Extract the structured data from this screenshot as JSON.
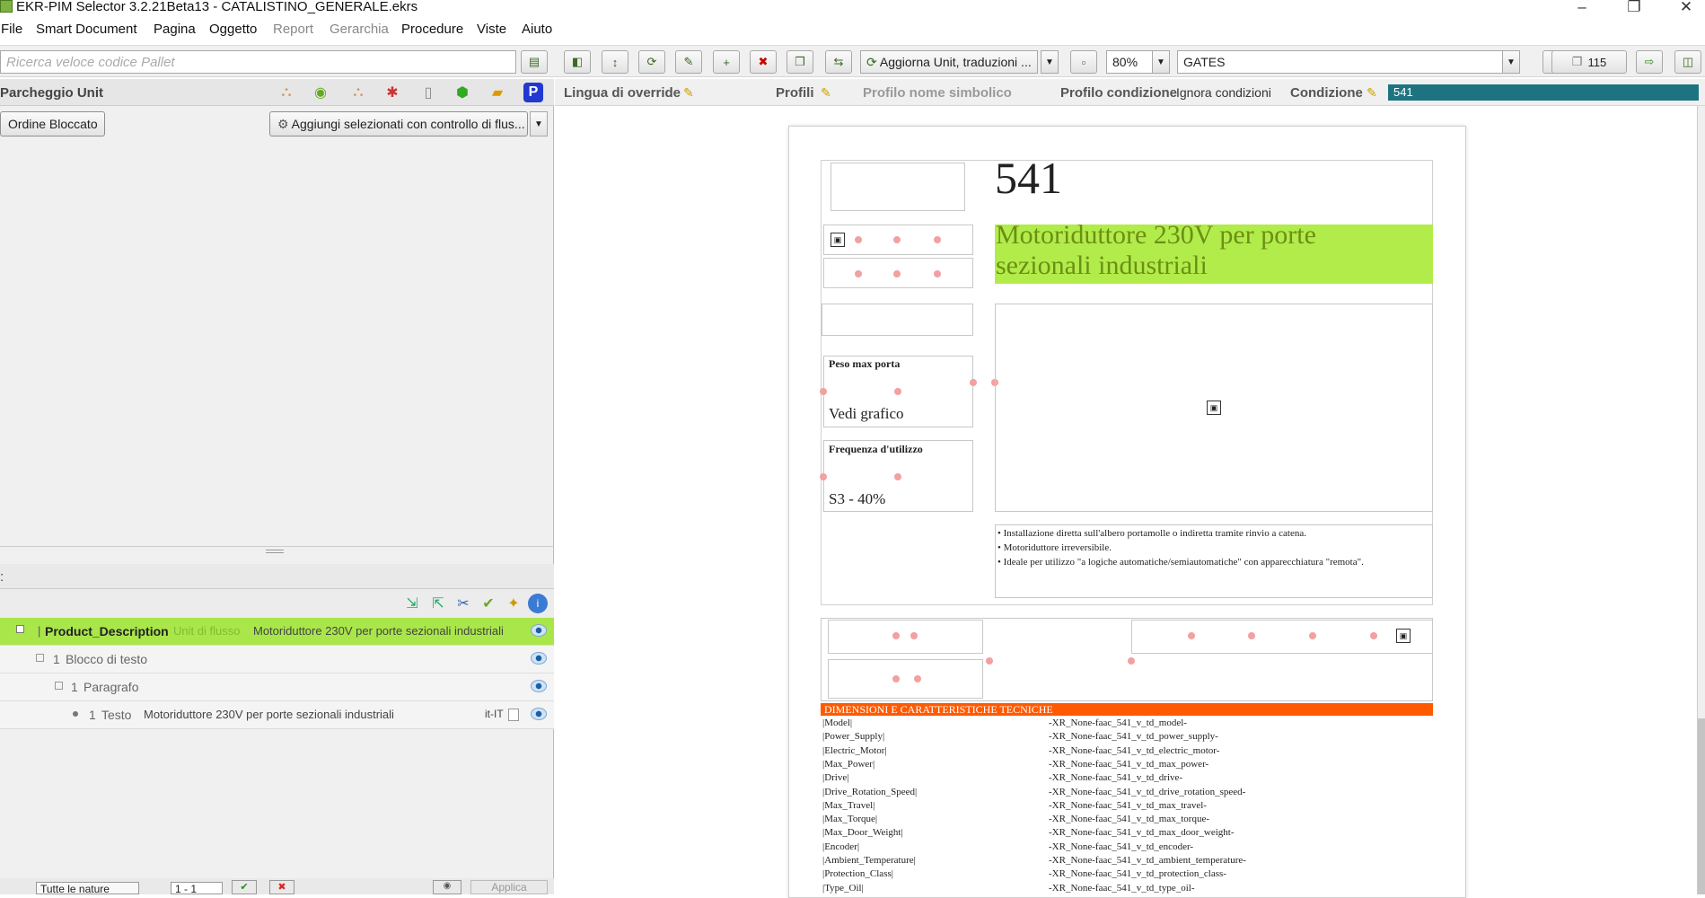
{
  "window": {
    "title": "EKR-PIM Selector 3.2.21Beta13 - CATALISTINO_GENERALE.ekrs",
    "minimize": "–",
    "restore": "❐",
    "close": "✕"
  },
  "menu": [
    "File",
    "Smart Document",
    "Pagina",
    "Oggetto",
    "Report",
    "Gerarchia",
    "Procedure",
    "Viste",
    "Aiuto"
  ],
  "toolbar": {
    "search_placeholder": "Ricerca veloce codice Pallet",
    "action_combo": "Aggiorna Unit, traduzioni ...",
    "zoom": "80%",
    "brand_combo": "GATES",
    "page_count": "115"
  },
  "left_panel": {
    "title": "Parcheggio Unit",
    "ordine_button": "Ordine Bloccato",
    "aggiungi_combo": "Aggiungi selezionati con controllo di flus...",
    "lower_title": ":",
    "tree": [
      {
        "label": "Product_Description",
        "type": "Unit di flusso",
        "text": "Motoriduttore 230V per porte sezionali industriali",
        "index": "1"
      },
      {
        "label": "Blocco di testo",
        "index": "1"
      },
      {
        "label": "Paragrafo",
        "index": "1"
      },
      {
        "label": "Testo",
        "index": "1",
        "text": "Motoriduttore 230V per porte sezionali industriali",
        "lang": "it-IT"
      }
    ],
    "bottom_filter": "Tutte le nature",
    "bottom_range": "1 - 1",
    "apply_label": "Applica"
  },
  "right_header": {
    "lingua_label": "Lingua di override",
    "profili_label": "Profili",
    "profilo_nome_label": "Profilo nome simbolico",
    "profilo_condizione_label": "Profilo condizione",
    "profilo_condizione_value": "Ignora condizioni",
    "condizione_label": "Condizione",
    "condizione_value": "541"
  },
  "document": {
    "code": "541",
    "title_line1": "Motoriduttore 230V per porte",
    "title_line2": "sezionali industriali",
    "peso_label": "Peso max porta",
    "peso_value": "Vedi grafico",
    "freq_label": "Frequenza d'utilizzo",
    "freq_value": "S3 - 40%",
    "bullets": [
      "• Installazione diretta sull'albero portamolle o indiretta tramite rinvio a catena.",
      "• Motoriduttore irreversibile.",
      "• Ideale per utilizzo \"a logiche automatiche/semiautomatiche\" con apparecchiatura \"remota\"."
    ],
    "section_title": "DIMENSIONI E CARATTERISTICHE TECNICHE",
    "specs": [
      {
        "k": "|Model|",
        "v": "-XR_None-faac_541_v_td_model-"
      },
      {
        "k": "|Power_Supply|",
        "v": "-XR_None-faac_541_v_td_power_supply-"
      },
      {
        "k": "|Electric_Motor|",
        "v": "-XR_None-faac_541_v_td_electric_motor-"
      },
      {
        "k": "|Max_Power|",
        "v": "-XR_None-faac_541_v_td_max_power-"
      },
      {
        "k": "|Drive|",
        "v": "-XR_None-faac_541_v_td_drive-"
      },
      {
        "k": "|Drive_Rotation_Speed|",
        "v": "-XR_None-faac_541_v_td_drive_rotation_speed-"
      },
      {
        "k": "|Max_Travel|",
        "v": "-XR_None-faac_541_v_td_max_travel-"
      },
      {
        "k": "|Max_Torque|",
        "v": "-XR_None-faac_541_v_td_max_torque-"
      },
      {
        "k": "|Max_Door_Weight|",
        "v": "-XR_None-faac_541_v_td_max_door_weight-"
      },
      {
        "k": "|Encoder|",
        "v": "-XR_None-faac_541_v_td_encoder-"
      },
      {
        "k": "|Ambient_Temperature|",
        "v": "-XR_None-faac_541_v_td_ambient_temperature-"
      },
      {
        "k": "|Protection_Class|",
        "v": "-XR_None-faac_541_v_td_protection_class-"
      },
      {
        "k": "|Type_Oil|",
        "v": "-XR_None-faac_541_v_td_type_oil-"
      }
    ]
  },
  "colors": {
    "accent_green": "#a9e64a",
    "section_orange": "#ff5a00",
    "condition_teal": "#1d7480"
  }
}
